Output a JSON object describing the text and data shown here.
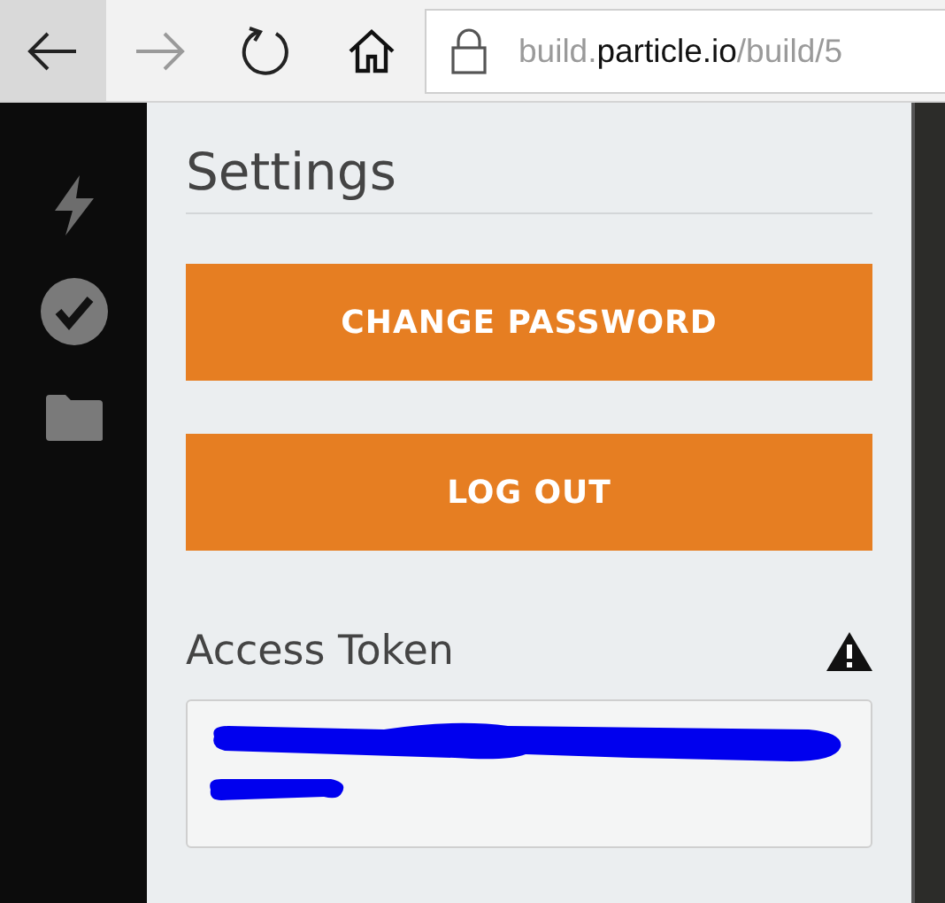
{
  "browser": {
    "url": {
      "prefix": "build.",
      "domain": "particle.io",
      "path": "/build/5"
    }
  },
  "sidebar": {
    "items": [
      {
        "kind": "flash"
      },
      {
        "kind": "verify"
      },
      {
        "kind": "files"
      }
    ]
  },
  "settings": {
    "title": "Settings",
    "buttons": [
      "CHANGE PASSWORD",
      "LOG OUT"
    ],
    "access_token": {
      "label": "Access Token",
      "redacted": true
    }
  }
}
